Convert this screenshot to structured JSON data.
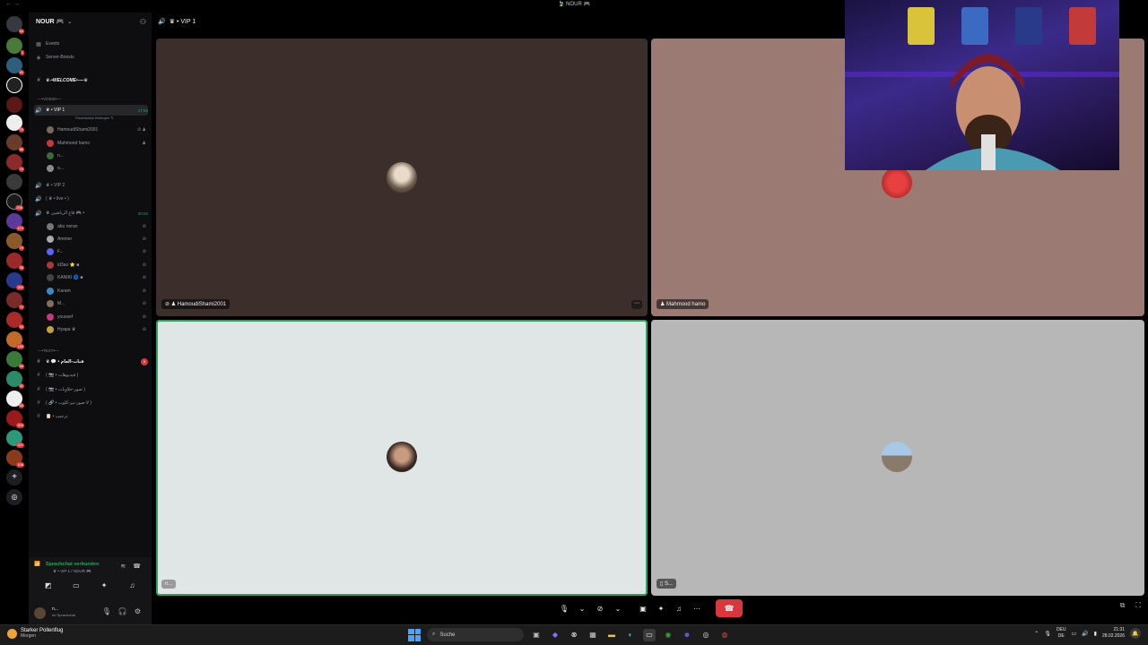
{
  "window": {
    "title": "🍃 NOUR 🎮"
  },
  "server_rail": {
    "badges": [
      "34",
      "2",
      "41",
      "70",
      "86",
      "74",
      "47",
      "4",
      "6",
      "38",
      "206",
      "20",
      "479",
      "79",
      "38",
      "76",
      "283",
      "72",
      "53",
      "189",
      "66",
      "31",
      "55",
      "300",
      "321",
      "108"
    ]
  },
  "sidebar": {
    "guild_name": "NOUR 🎮",
    "events": "Events",
    "boosts": "Server-Boosts",
    "welcome_channel": "♛-•WELCOME•-—♛",
    "voice_category": "—•VOICE•—",
    "channels": {
      "vip1": "♛ • VIP 1",
      "vip1_time": "17:59",
      "vip1_status": "Panelstatus festlegen ✎",
      "vip2": "♛ • VIP 2",
      "live": "( ♛ • live • )",
      "room3": "♛ قاع الرياضين 🎮 •",
      "room3_time": "20:03",
      "text_category": "—•TEXT•—",
      "t1": "♛ 💬 • قنات-العام",
      "t1_badge": "1",
      "t2": "( 📷 • فيديوهات )",
      "t3": "( 📷 • صور-حلاويات )",
      "t4": "( 🔗 • لا-صور-نيز-كلوب )",
      "t5": "📋 • ترحيب"
    },
    "vip1_members": [
      "HamoudiShami2001",
      "Mahmood hamo",
      "n...",
      "o..."
    ],
    "room3_members": [
      "abu noran",
      "Ammer",
      "F...",
      "id3ao ⭐ ■",
      "KANIKI 🌀 ■",
      "Karam",
      "M...",
      "youssef",
      "Hyapa ♛"
    ]
  },
  "voice_panel": {
    "status": "Sprachchat verbunden",
    "sub": "♛ • VIP 1 / NOUR 🎮"
  },
  "user_panel": {
    "name": "n...",
    "status": "Im Sprachchat"
  },
  "call": {
    "header": "♛ • VIP 1",
    "tiles": [
      {
        "name": "HamoudiShami2001",
        "bg": "#3b2e2b"
      },
      {
        "name": "Mahmood hamo",
        "bg": "#9a7a72"
      },
      {
        "name": "n...",
        "bg": "#dfe6e5"
      },
      {
        "name": "S...",
        "bg": "#b7b7b7"
      }
    ]
  },
  "taskbar": {
    "weather_title": "Starker Pollenflug",
    "weather_sub": "Morgen",
    "search_placeholder": "Suche",
    "lang_top": "DEU",
    "lang_bottom": "DE",
    "time": "21:31",
    "date": "28.02.2026"
  }
}
